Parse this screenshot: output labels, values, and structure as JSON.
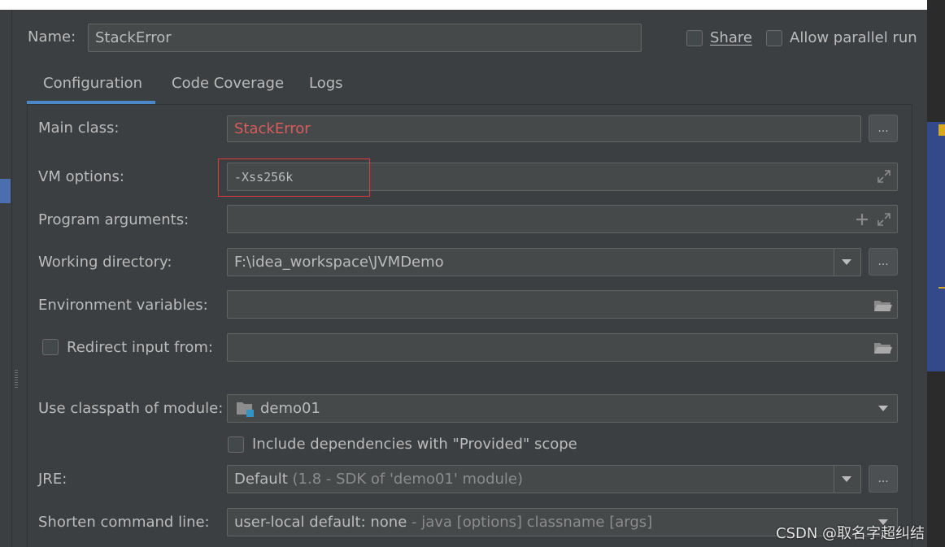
{
  "header": {
    "name_label": "Name:",
    "name_value": "StackError",
    "share_label": "Share",
    "allow_parallel_label": "Allow parallel run"
  },
  "tabs": [
    {
      "label": "Configuration",
      "active": true
    },
    {
      "label": "Code Coverage",
      "active": false
    },
    {
      "label": "Logs",
      "active": false
    }
  ],
  "form": {
    "main_class_label": "Main class:",
    "main_class_value": "StackError",
    "vm_options_label": "VM options:",
    "vm_options_value": "-Xss256k",
    "program_args_label": "Program arguments:",
    "program_args_value": "",
    "working_dir_label": "Working directory:",
    "working_dir_value": "F:\\idea_workspace\\JVMDemo",
    "env_vars_label": "Environment variables:",
    "env_vars_value": "",
    "redirect_label": "Redirect input from:",
    "redirect_value": "",
    "classpath_label": "Use classpath of module:",
    "classpath_value": "demo01",
    "include_deps_label": "Include dependencies with \"Provided\" scope",
    "jre_label": "JRE:",
    "jre_value": "Default",
    "jre_detail": "(1.8 - SDK of 'demo01' module)",
    "shorten_label": "Shorten command line:",
    "shorten_value": "user-local default: none",
    "shorten_detail": "- java [options] classname [args]",
    "browse_label": "..."
  },
  "watermark": "CSDN @取名字超纠结",
  "colors": {
    "error_red": "#d95c5c",
    "highlight_box": "#e0393e",
    "tab_underline": "#4a88c7",
    "module_icon_accent": "#3592c4"
  },
  "icons": {
    "expand": "expand-icon",
    "plus": "plus-icon",
    "folder": "folder-icon",
    "module": "module-icon",
    "dropdown": "chevron-down-icon"
  }
}
